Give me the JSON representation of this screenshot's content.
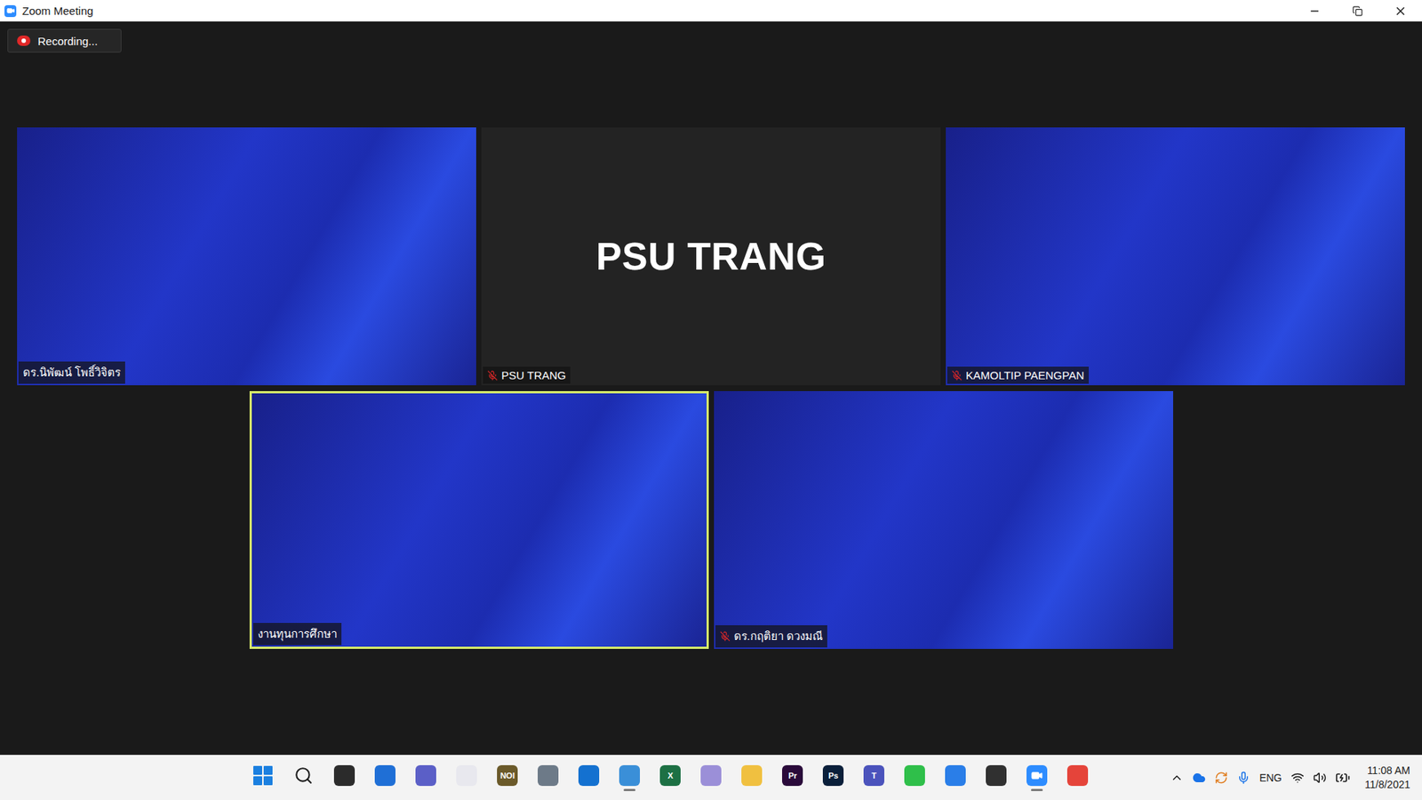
{
  "window": {
    "title": "Zoom Meeting"
  },
  "recording": {
    "label": "Recording..."
  },
  "participants": [
    {
      "name": "ดร.นิพัฒน์ โพธิ์วิจิตร",
      "kind": "video",
      "muted": false,
      "speaking": false
    },
    {
      "name": "PSU TRANG",
      "kind": "avatar",
      "muted": true,
      "speaking": false
    },
    {
      "name": "KAMOLTIP PAENGPAN",
      "kind": "video",
      "muted": true,
      "speaking": false
    },
    {
      "name": "งานทุนการศึกษา",
      "kind": "video",
      "muted": false,
      "speaking": true
    },
    {
      "name": "ดร.กฤติยา ดวงมณี",
      "kind": "video",
      "muted": true,
      "speaking": false
    }
  ],
  "taskbar": {
    "apps": [
      {
        "kind": "start",
        "glyph": "",
        "color": "#1a7fe0",
        "active": false
      },
      {
        "kind": "search",
        "glyph": "",
        "color": "#202020",
        "active": false
      },
      {
        "kind": "app",
        "glyph": "",
        "color": "#2b2b2b",
        "active": false
      },
      {
        "kind": "app",
        "glyph": "",
        "color": "#1f6fd6",
        "active": false
      },
      {
        "kind": "app",
        "glyph": "",
        "color": "#5b5fc7",
        "active": false
      },
      {
        "kind": "app",
        "glyph": "",
        "color": "#e8e8ee",
        "active": false
      },
      {
        "kind": "app",
        "glyph": "NOI",
        "color": "#6b5a2a",
        "active": false
      },
      {
        "kind": "app",
        "glyph": "",
        "color": "#6d7a88",
        "active": false
      },
      {
        "kind": "app",
        "glyph": "",
        "color": "#1471d0",
        "active": false
      },
      {
        "kind": "app",
        "glyph": "",
        "color": "#3a8fd8",
        "active": true
      },
      {
        "kind": "app",
        "glyph": "X",
        "color": "#1d7044",
        "active": false
      },
      {
        "kind": "app",
        "glyph": "",
        "color": "#9b8fd8",
        "active": false
      },
      {
        "kind": "app",
        "glyph": "",
        "color": "#f0c040",
        "active": false
      },
      {
        "kind": "app",
        "glyph": "Pr",
        "color": "#2a0a3a",
        "active": false
      },
      {
        "kind": "app",
        "glyph": "Ps",
        "color": "#0a1f3a",
        "active": false
      },
      {
        "kind": "app",
        "glyph": "T",
        "color": "#4b53bc",
        "active": false
      },
      {
        "kind": "app",
        "glyph": "",
        "color": "#2fbf4a",
        "active": false
      },
      {
        "kind": "app",
        "glyph": "",
        "color": "#2a7ee8",
        "active": false
      },
      {
        "kind": "app",
        "glyph": "",
        "color": "#303030",
        "active": false
      },
      {
        "kind": "zoom",
        "glyph": "",
        "color": "#2d8cff",
        "active": true
      },
      {
        "kind": "app",
        "glyph": "",
        "color": "#e5443a",
        "active": false
      }
    ],
    "tray": {
      "language": "ENG",
      "time": "11:08 AM",
      "date": "11/8/2021"
    }
  }
}
